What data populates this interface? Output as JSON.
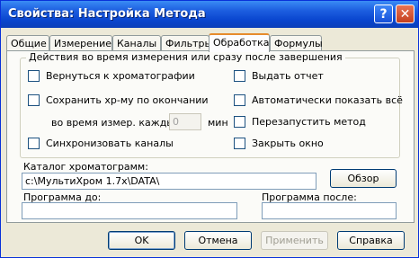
{
  "window": {
    "title": "Свойства: Настройка Метода"
  },
  "titlebar_buttons": {
    "help": "?",
    "close": "✕"
  },
  "tabs": [
    {
      "label": "Общие",
      "active": false
    },
    {
      "label": "Измерение",
      "active": false
    },
    {
      "label": "Каналы",
      "active": false
    },
    {
      "label": "Фильтры",
      "active": false
    },
    {
      "label": "Обработка",
      "active": true
    },
    {
      "label": "Формулы",
      "active": false
    }
  ],
  "group": {
    "legend": "Действия во время измерения или сразу после завершения",
    "return_chrom": "Вернуться к хроматографии",
    "save_chrom": "Сохранить хр-му по окончании",
    "during_measure": "во время измер. каждые",
    "interval_value": "0",
    "interval_unit": "мин",
    "sync_channels": "Синхронизовать каналы",
    "issue_report": "Выдать отчет",
    "auto_show_all": "Автоматически показать всё",
    "restart_method": "Перезапустить метод",
    "close_window": "Закрыть окно"
  },
  "catalog": {
    "label": "Каталог хроматограмм:",
    "value": "c:\\МультиХром 1.7x\\DATA\\",
    "browse_button": "Обзор"
  },
  "program_before": {
    "label": "Программа до:",
    "value": ""
  },
  "program_after": {
    "label": "Программа после:",
    "value": ""
  },
  "buttons": {
    "ok": "OK",
    "cancel": "Отмена",
    "apply": "Применить",
    "help": "Справка"
  }
}
